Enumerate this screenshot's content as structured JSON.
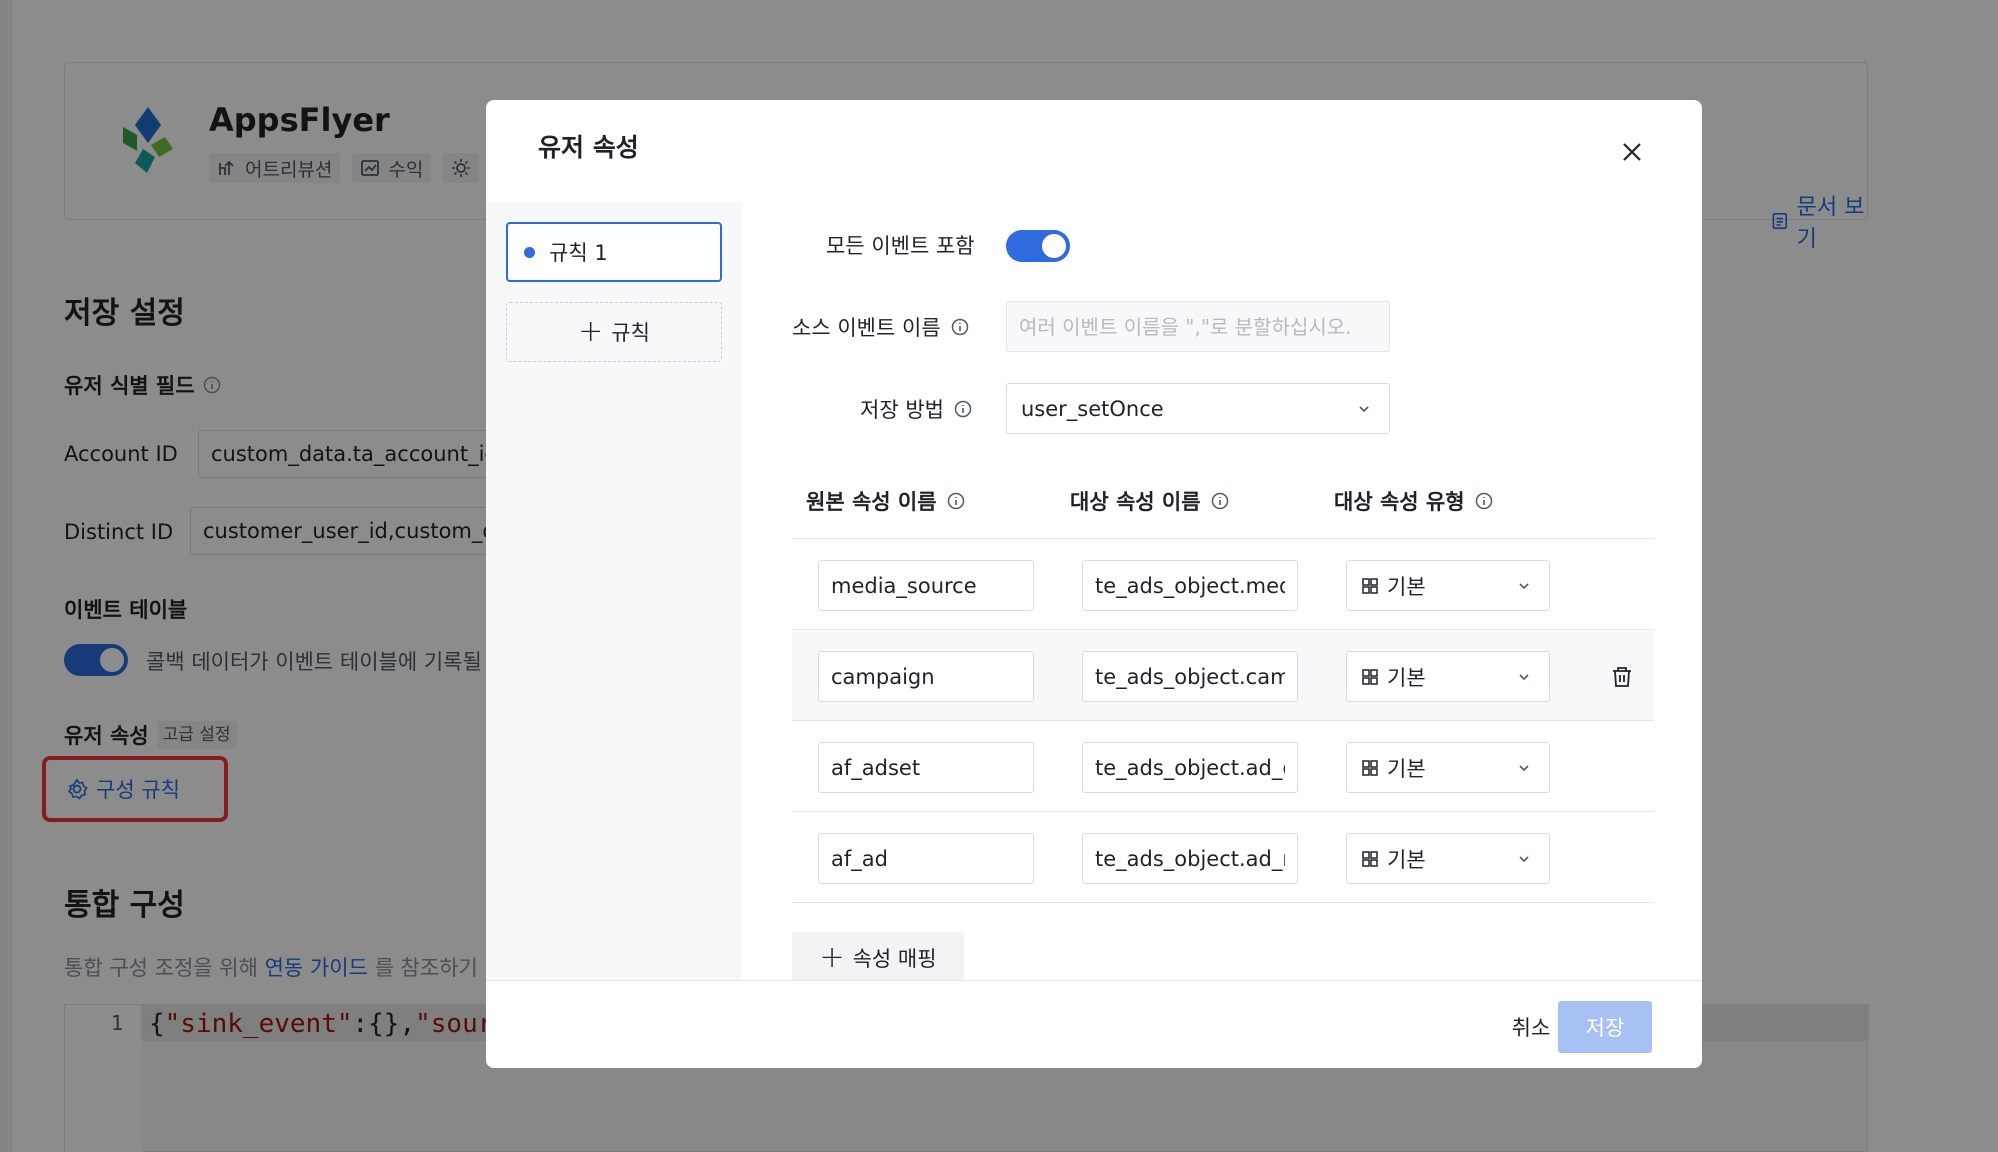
{
  "app": {
    "name": "AppsFlyer",
    "tags": [
      "어트리뷰션",
      "수익"
    ],
    "doc_link": "문서 보기"
  },
  "storage": {
    "title": "저장 설정",
    "user_id_field_title": "유저 식별 필드",
    "account_id_label": "Account ID",
    "account_id_value": "custom_data.ta_account_id",
    "distinct_id_label": "Distinct ID",
    "distinct_id_value": "customer_user_id,custom_da",
    "event_table_title": "이벤트 테이블",
    "event_table_text": "콜백 데이터가 이벤트 테이블에 기록될",
    "user_props_title": "유저 속성",
    "advanced_badge": "고급 설정",
    "config_rule_link": "구성 규칙"
  },
  "integration": {
    "title": "통합 구성",
    "guide_prefix": "통합 구성 조정을 위해",
    "guide_link": "연동 가이드",
    "guide_suffix": "를 참조하기",
    "code_line_number": "1",
    "code_text_1": "{",
    "code_str_1": "\"sink_event\"",
    "code_text_2": ":{},",
    "code_str_2": "\"sour"
  },
  "modal": {
    "title": "유저 속성",
    "rules": [
      {
        "label": "규칙 1",
        "active": true
      }
    ],
    "add_rule_label": "규칙",
    "include_all_label": "모든 이벤트 포함",
    "include_all": true,
    "source_event_label": "소스 이벤트 이름",
    "source_event_placeholder": "여러 이벤트 이름을 \",\"로 분할하십시오.",
    "source_event_value": "",
    "store_method_label": "저장 방법",
    "store_method_value": "user_setOnce",
    "columns": {
      "source": "원본 속성 이름",
      "target": "대상 속성 이름",
      "type": "대상 속성 유형"
    },
    "mappings": [
      {
        "source": "media_source",
        "target": "te_ads_object.media_source",
        "type": "기본"
      },
      {
        "source": "campaign",
        "target": "te_ads_object.campaign",
        "type": "기본"
      },
      {
        "source": "af_adset",
        "target": "te_ads_object.ad_group",
        "type": "기본"
      },
      {
        "source": "af_ad",
        "target": "te_ads_object.ad_name",
        "type": "기본"
      }
    ],
    "add_mapping_label": "속성 매핑",
    "cancel_label": "취소",
    "save_label": "저장"
  },
  "colors": {
    "primary": "#2f6bdf",
    "save_disabled": "#a7c1f4",
    "highlight_box": "#f2333a"
  }
}
